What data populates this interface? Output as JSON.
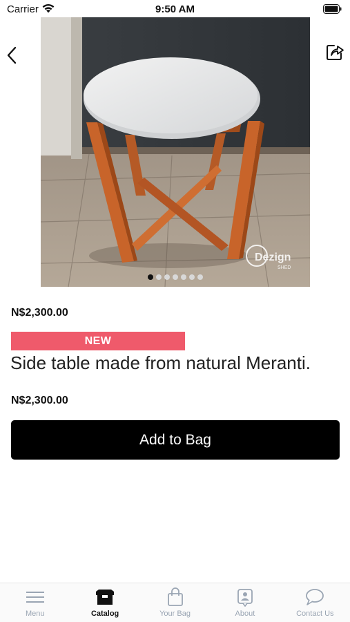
{
  "status_bar": {
    "carrier": "Carrier",
    "time": "9:50 AM"
  },
  "navigation": {
    "back_icon": "chevron-left-icon",
    "share_icon": "share-icon"
  },
  "product": {
    "image_subject": "side-table-photo",
    "watermark": "Dezign SHED",
    "carousel_pages": 7,
    "carousel_active_index": 0,
    "price_top": "N$2,300.00",
    "badge": "NEW",
    "title": "Side table made from natural Meranti.",
    "price_bottom": "N$2,300.00",
    "add_to_bag_label": "Add to Bag"
  },
  "colors": {
    "badge": "#ef5a6b",
    "button": "#000000",
    "tab_inactive": "#9aa5b3"
  },
  "tab_bar": {
    "active": "Catalog",
    "items": [
      {
        "label": "Menu",
        "icon": "menu-icon"
      },
      {
        "label": "Catalog",
        "icon": "catalog-box-icon"
      },
      {
        "label": "Your Bag",
        "icon": "bag-icon"
      },
      {
        "label": "About",
        "icon": "about-contact-card-icon"
      },
      {
        "label": "Contact Us",
        "icon": "chat-bubble-icon"
      }
    ]
  }
}
